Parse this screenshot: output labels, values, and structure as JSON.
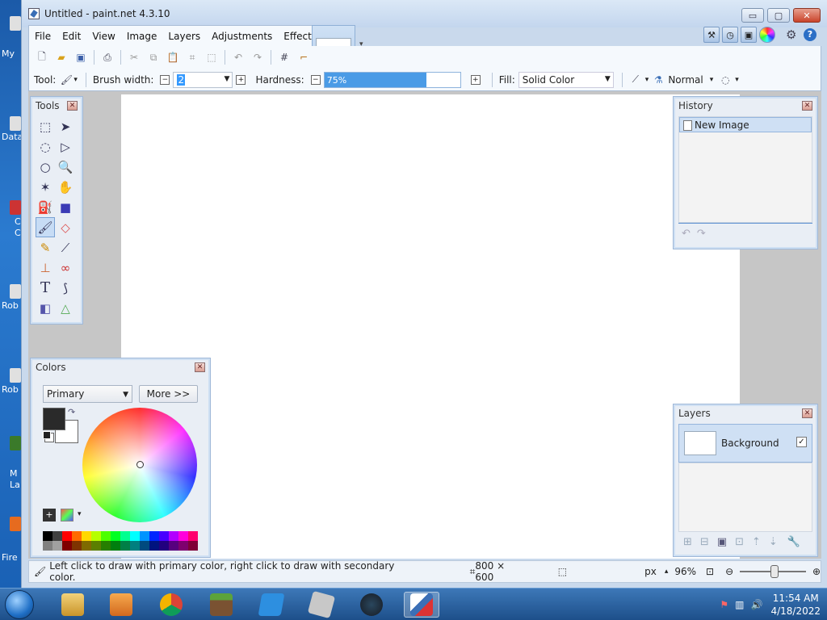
{
  "window": {
    "title": "Untitled - paint.net 4.3.10",
    "minimize_label": "▭",
    "maximize_label": "▢",
    "close_label": "✕"
  },
  "menu": [
    "File",
    "Edit",
    "View",
    "Image",
    "Layers",
    "Adjustments",
    "Effects"
  ],
  "toolbar2": {
    "tool_label": "Tool:",
    "brush_width_label": "Brush width:",
    "brush_width_value": "2",
    "hardness_label": "Hardness:",
    "hardness_value": "75%",
    "hardness_fraction": 0.75,
    "fill_label": "Fill:",
    "fill_value": "Solid Color",
    "blend_mode": "Normal"
  },
  "tools_panel": {
    "title": "Tools"
  },
  "history_panel": {
    "title": "History",
    "items": [
      "New Image"
    ]
  },
  "colors_panel": {
    "title": "Colors",
    "mode": "Primary",
    "more_label": "More >>",
    "primary_color": "#2a2a2a",
    "secondary_color": "#ffffff"
  },
  "layers_panel": {
    "title": "Layers",
    "layers": [
      {
        "name": "Background",
        "visible": true
      }
    ]
  },
  "status": {
    "hint": "Left click to draw with primary color, right click to draw with secondary color.",
    "image_size": "800 × 600",
    "units": "px",
    "zoom": "96%"
  },
  "desktop_labels": [
    "My",
    "Data",
    "C",
    "C",
    "Rob",
    "Rob",
    "M",
    "La",
    "Fire"
  ],
  "taskbar": {
    "time": "11:54 AM",
    "date": "4/18/2022"
  },
  "palette_colors": [
    "#000000",
    "#404040",
    "#ff0000",
    "#ff6a00",
    "#ffd800",
    "#b6ff00",
    "#4cff00",
    "#00ff21",
    "#00ff90",
    "#00ffff",
    "#0094ff",
    "#0026ff",
    "#4800ff",
    "#b200ff",
    "#ff00dc",
    "#ff006e",
    "#808080",
    "#a0a0a0",
    "#7f0000",
    "#7f3300",
    "#7f6a00",
    "#5b7f00",
    "#267f00",
    "#007f0e",
    "#007f46",
    "#007f7f",
    "#004a7f",
    "#00137f",
    "#21007f",
    "#57007f",
    "#7f006e",
    "#7f0037"
  ]
}
